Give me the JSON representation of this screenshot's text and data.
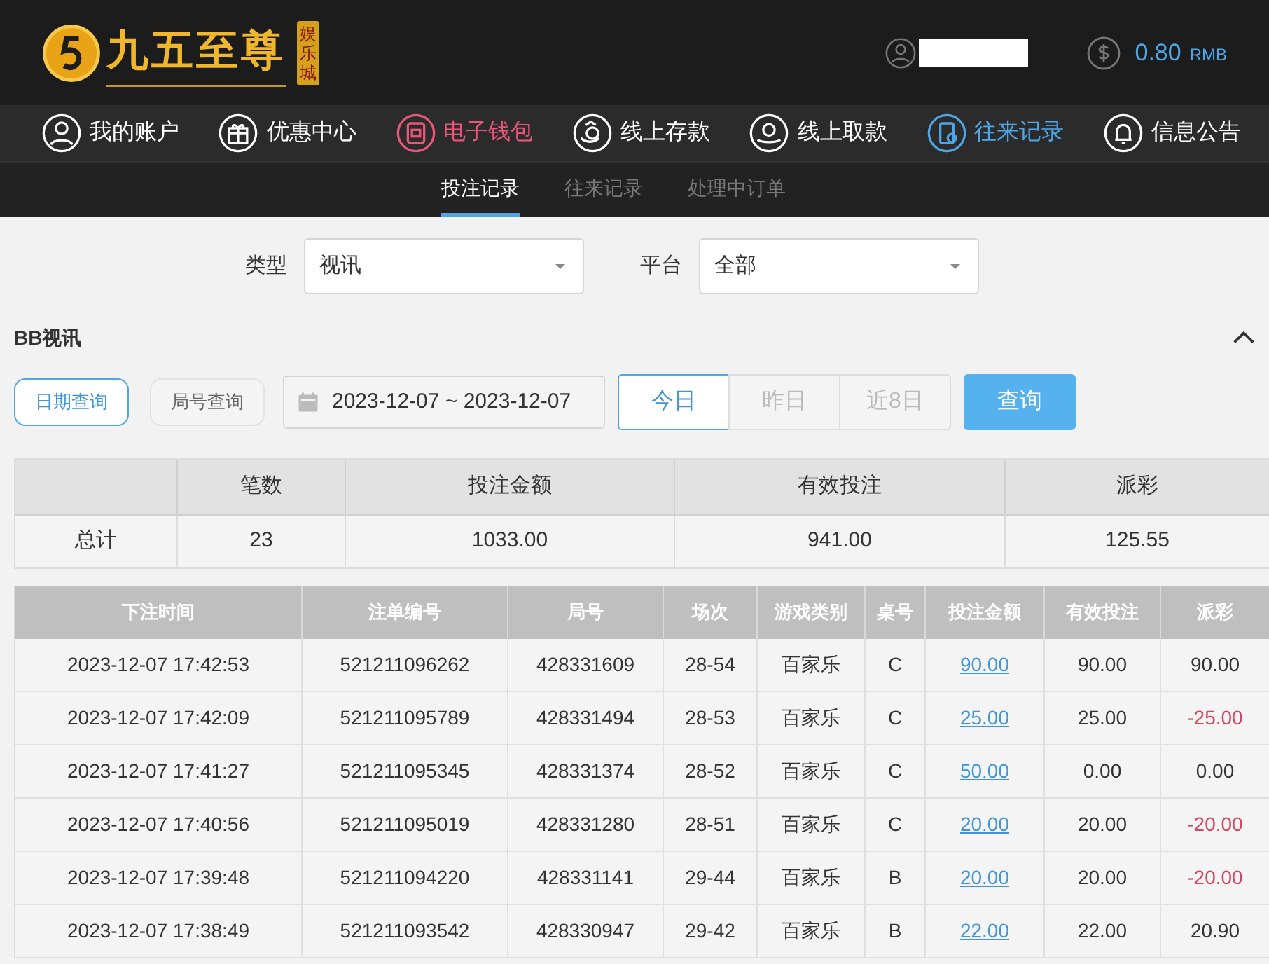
{
  "header": {
    "logo": {
      "name": "九五至尊",
      "badge": "娱乐城"
    },
    "balance": "0.80",
    "currency": "RMB"
  },
  "nav": [
    {
      "label": "我的账户",
      "kind": "user",
      "color": "#ffffff"
    },
    {
      "label": "优惠中心",
      "kind": "gift",
      "color": "#ffffff"
    },
    {
      "label": "电子钱包",
      "kind": "wallet",
      "color": "#e8567a"
    },
    {
      "label": "线上存款",
      "kind": "deposit",
      "color": "#ffffff"
    },
    {
      "label": "线上取款",
      "kind": "withdraw",
      "color": "#ffffff"
    },
    {
      "label": "往来记录",
      "kind": "record",
      "color": "#4ea6e6"
    },
    {
      "label": "信息公告",
      "kind": "bell",
      "color": "#ffffff"
    }
  ],
  "subtabs": [
    {
      "label": "投注记录",
      "selected": true
    },
    {
      "label": "往来记录",
      "selected": false
    },
    {
      "label": "处理中订单",
      "selected": false
    }
  ],
  "filters": [
    {
      "label": "类型",
      "value": "视讯"
    },
    {
      "label": "平台",
      "value": "全部"
    }
  ],
  "section": {
    "title": "BB视讯",
    "expanded": true
  },
  "query_modes": [
    {
      "label": "日期查询",
      "selected": true
    },
    {
      "label": "局号查询",
      "selected": false
    }
  ],
  "date_range": "2023-12-07 ~ 2023-12-07",
  "quick_ranges": [
    {
      "label": "今日",
      "selected": true
    },
    {
      "label": "昨日",
      "selected": false
    },
    {
      "label": "近8日",
      "selected": false
    }
  ],
  "search_button": "查询",
  "summary": {
    "columns": [
      "笔数",
      "投注金额",
      "有效投注",
      "派彩"
    ],
    "row_label": "总计",
    "values": [
      "23",
      "1033.00",
      "941.00",
      "125.55"
    ]
  },
  "bets": {
    "columns": [
      "下注时间",
      "注单编号",
      "局号",
      "场次",
      "游戏类别",
      "桌号",
      "投注金额",
      "有效投注",
      "派彩"
    ],
    "rows": [
      {
        "cells": [
          "2023-12-07 17:42:53",
          "521211096262",
          "428331609",
          "28-54",
          "百家乐",
          "C",
          "90.00",
          "90.00",
          "90.00"
        ],
        "payout_negative": false
      },
      {
        "cells": [
          "2023-12-07 17:42:09",
          "521211095789",
          "428331494",
          "28-53",
          "百家乐",
          "C",
          "25.00",
          "25.00",
          "-25.00"
        ],
        "payout_negative": true
      },
      {
        "cells": [
          "2023-12-07 17:41:27",
          "521211095345",
          "428331374",
          "28-52",
          "百家乐",
          "C",
          "50.00",
          "0.00",
          "0.00"
        ],
        "payout_negative": false
      },
      {
        "cells": [
          "2023-12-07 17:40:56",
          "521211095019",
          "428331280",
          "28-51",
          "百家乐",
          "C",
          "20.00",
          "20.00",
          "-20.00"
        ],
        "payout_negative": true
      },
      {
        "cells": [
          "2023-12-07 17:39:48",
          "521211094220",
          "428331141",
          "29-44",
          "百家乐",
          "B",
          "20.00",
          "20.00",
          "-20.00"
        ],
        "payout_negative": true
      },
      {
        "cells": [
          "2023-12-07 17:38:49",
          "521211093542",
          "428330947",
          "29-42",
          "百家乐",
          "B",
          "22.00",
          "22.00",
          "20.90"
        ],
        "payout_negative": false
      }
    ]
  }
}
